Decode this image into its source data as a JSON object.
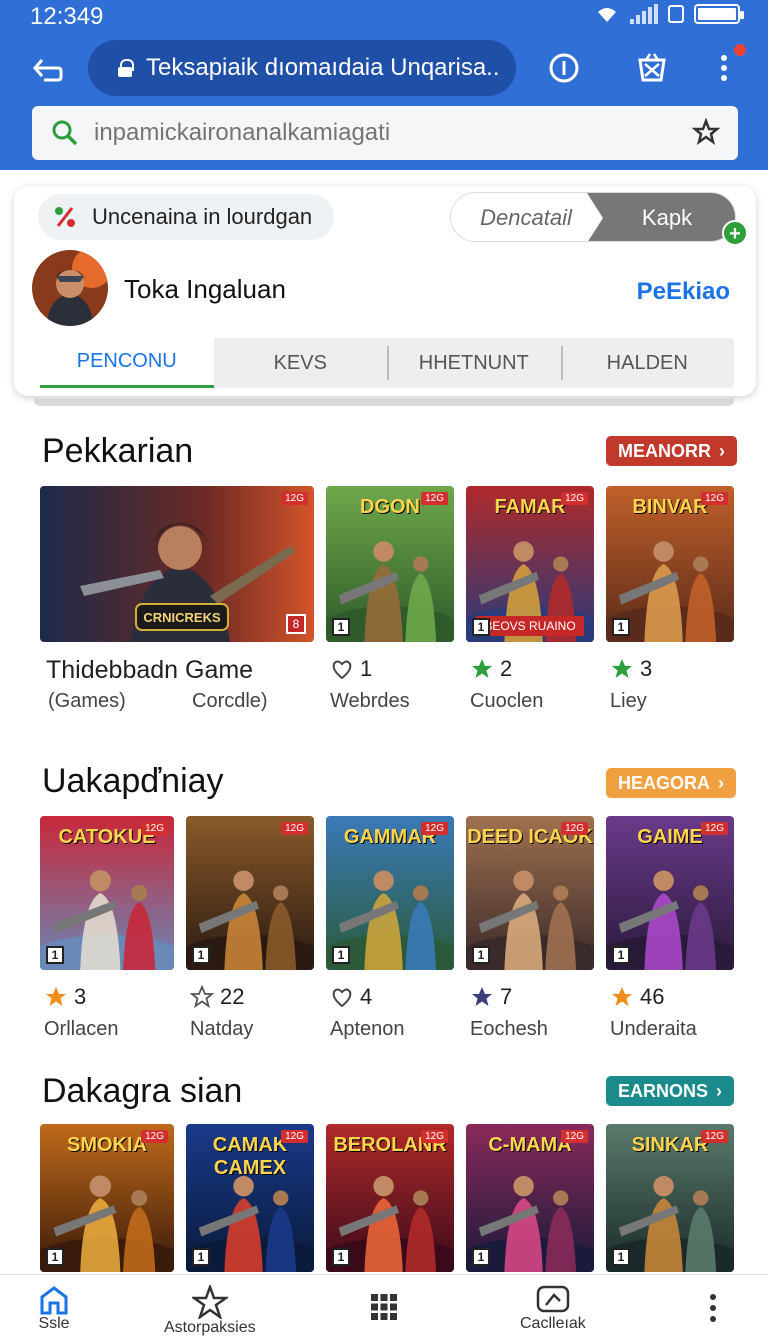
{
  "status": {
    "time": "12:349"
  },
  "browser": {
    "url": "Teksapiaik dıomaıdaia Unqarisa..",
    "search_placeholder": "inpamickaironanalkamiagati"
  },
  "card": {
    "promo_chip": "Uncenaina in lourdgan",
    "segment_left": "Dencatail",
    "segment_right": "Kapk",
    "user_name": "Toka Ingaluan",
    "user_link": "PeEkiao",
    "tabs": [
      "PENCONU",
      "KEVS",
      "HHETNUNT",
      "HALDEN"
    ]
  },
  "sections": [
    {
      "title": "Pekkarian",
      "action": "MEANORR",
      "action_color": "#c0392b",
      "featured": {
        "art_title": "CRNICREKS",
        "name": "Thidebbadn Game",
        "sub_left": "(Games)",
        "sub_right": "Corcdle)"
      },
      "items": [
        {
          "art_title": "DGON",
          "rating": "1",
          "icon": "heart-outline-icon",
          "label": "Webrdes"
        },
        {
          "art_title": "FAMAR",
          "banner": "BEOVS RUAINO",
          "rating": "2",
          "icon": "star-green-icon",
          "label": "Cuoclen"
        },
        {
          "art_title": "BINVAR",
          "rating": "3",
          "icon": "star-green-icon",
          "label": "Liey"
        }
      ]
    },
    {
      "title": "Uakapďniay",
      "action": "HEAGORA",
      "action_color": "#f0a040",
      "items": [
        {
          "art_title": "CATOKUE",
          "rating": "3",
          "icon": "star-orange-icon",
          "label": "Orllacen"
        },
        {
          "art_title": "",
          "rating": "22",
          "icon": "star-outline-icon",
          "label": "Natday"
        },
        {
          "art_title": "GAMMAR",
          "rating": "4",
          "icon": "heart-outline-icon",
          "label": "Aptenon"
        },
        {
          "art_title": "DEED ICAOK",
          "rating": "7",
          "icon": "star-navy-icon",
          "label": "Eochesh"
        },
        {
          "art_title": "GAIME",
          "rating": "46",
          "icon": "star-orange-icon",
          "label": "Underaita"
        }
      ]
    },
    {
      "title": "Dakagra sian",
      "action": "EARNONS",
      "action_color": "#1a8a8a",
      "items": [
        {
          "art_title": "SMOKIA"
        },
        {
          "art_title": "CAMAK CAMEX"
        },
        {
          "art_title": "BEROLANR"
        },
        {
          "art_title": "C-MAMA"
        },
        {
          "art_title": "SINKAR"
        }
      ]
    }
  ],
  "bottom_nav": [
    "Ssle",
    "Astorpaksies",
    "",
    "Caclleıak",
    ""
  ],
  "colors": {
    "toolbar": "#2f6fd6",
    "url_pill": "#1f4fa6",
    "accent": "#1a73e8",
    "active_tab_underline": "#2ea043"
  }
}
